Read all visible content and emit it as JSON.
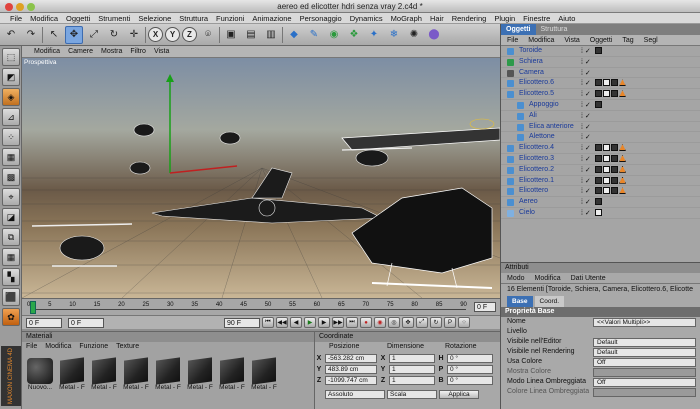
{
  "window": {
    "title": "aereo ed elicotter hdri senza vray 2.c4d *"
  },
  "menubar": [
    "File",
    "Modifica",
    "Oggetti",
    "Strumenti",
    "Selezione",
    "Struttura",
    "Funzioni",
    "Animazione",
    "Personaggio",
    "Dynamics",
    "MoGraph",
    "Hair",
    "Rendering",
    "Plugin",
    "Finestre",
    "Aiuto"
  ],
  "toolbar": {
    "axes": [
      "X",
      "Y",
      "Z"
    ]
  },
  "viewport": {
    "menu": [
      "Modifica",
      "Camere",
      "Mostra",
      "Filtro",
      "Vista"
    ],
    "label": "Prospettiva"
  },
  "timeline": {
    "ticks": [
      "0",
      "5",
      "10",
      "15",
      "20",
      "25",
      "30",
      "35",
      "40",
      "45",
      "50",
      "55",
      "60",
      "65",
      "70",
      "75",
      "80",
      "85",
      "90"
    ],
    "end_label": "0 F"
  },
  "transport": {
    "current_frame": "0 F",
    "start_frame": "0 F",
    "end_frame": "90 F"
  },
  "materials": {
    "header": "Materiali",
    "menu": [
      "File",
      "Modifica",
      "Funzione",
      "Texture"
    ],
    "items": [
      "Nuovo...",
      "Metal - F",
      "Metal - F",
      "Metal - F",
      "Metal - F",
      "Metal - F",
      "Metal - F",
      "Metal - F"
    ]
  },
  "coords": {
    "header": "Coordinate",
    "cols": [
      "Posizione",
      "Dimensione",
      "Rotazione"
    ],
    "rows": [
      {
        "axis": "X",
        "pos": "-563.282 cm",
        "dim": "1",
        "rot_axis": "H",
        "rot": "0 °"
      },
      {
        "axis": "Y",
        "pos": "483.89 cm",
        "dim": "1",
        "rot_axis": "P",
        "rot": "0 °"
      },
      {
        "axis": "Z",
        "pos": "-1099.747 cm",
        "dim": "1",
        "rot_axis": "B",
        "rot": "0 °"
      }
    ],
    "mode": "Assoluto",
    "scale": "Scala",
    "apply": "Applica"
  },
  "objects": {
    "tabs": [
      "Oggetti",
      "Struttura"
    ],
    "menu": [
      "File",
      "Modifica",
      "Vista",
      "Oggetti",
      "Tag",
      "Segl"
    ],
    "list": [
      {
        "name": "Toroide",
        "indent": 0
      },
      {
        "name": "Schiera",
        "indent": 0
      },
      {
        "name": "Camera",
        "indent": 0
      },
      {
        "name": "Elicottero.6",
        "indent": 0
      },
      {
        "name": "Elicottero.5",
        "indent": 0
      },
      {
        "name": "Appoggio",
        "indent": 1
      },
      {
        "name": "Ali",
        "indent": 1
      },
      {
        "name": "Elica anteriore",
        "indent": 1
      },
      {
        "name": "Alettone",
        "indent": 1
      },
      {
        "name": "Elicottero.4",
        "indent": 0
      },
      {
        "name": "Elicottero.3",
        "indent": 0
      },
      {
        "name": "Elicottero.2",
        "indent": 0
      },
      {
        "name": "Elicottero.1",
        "indent": 0
      },
      {
        "name": "Elicottero",
        "indent": 0
      },
      {
        "name": "Aereo",
        "indent": 0
      },
      {
        "name": "Cielo",
        "indent": 0
      }
    ]
  },
  "attributes": {
    "header": "Attributi",
    "menu": [
      "Modo",
      "Modifica",
      "Dati Utente"
    ],
    "summary": "16 Elementi [Toroide, Schiera, Camera, Elicottero.6, Elicotte",
    "tabs": [
      "Base",
      "Coord."
    ],
    "section": "Proprietà Base",
    "rows": [
      {
        "k": "Nome",
        "v": "<<Valori Multipli>>"
      },
      {
        "k": "Livello",
        "v": ""
      },
      {
        "k": "Visibile nell'Editor",
        "v": "Default"
      },
      {
        "k": "Visibile nel Rendering",
        "v": "Default"
      },
      {
        "k": "Usa Colore",
        "v": "Off"
      },
      {
        "k": "Mostra Colore",
        "v": ""
      },
      {
        "k": "Modo Linea Ombreggiata",
        "v": "Off"
      },
      {
        "k": "Colore Linea Ombreggiata",
        "v": ""
      }
    ]
  },
  "brand": "MAXON CINEMA 4D"
}
